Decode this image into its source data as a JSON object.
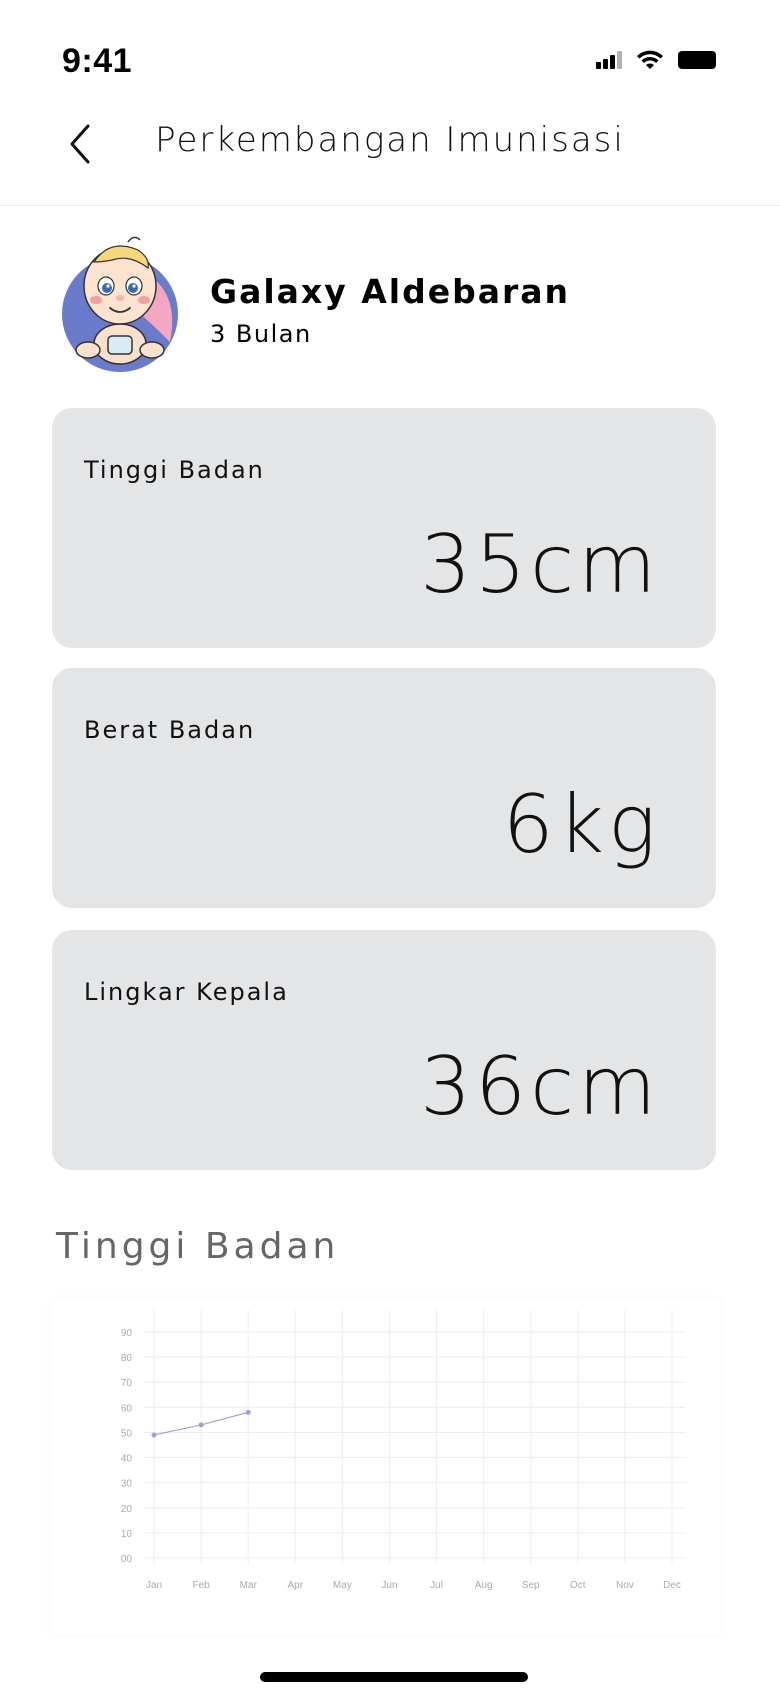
{
  "status": {
    "time": "9:41"
  },
  "nav": {
    "title": "Perkembangan Imunisasi"
  },
  "profile": {
    "name": "Galaxy Aldebaran",
    "age": "3 Bulan"
  },
  "metrics": [
    {
      "label": "Tinggi Badan",
      "value": "35cm"
    },
    {
      "label": "Berat Badan",
      "value": "6kg"
    },
    {
      "label": "Lingkar Kepala",
      "value": "36cm"
    }
  ],
  "chart_section": {
    "title": "Tinggi Badan"
  },
  "chart_data": {
    "type": "line",
    "title": "",
    "xlabel": "",
    "ylabel": "",
    "categories": [
      "Jan",
      "Feb",
      "Mar",
      "Apr",
      "May",
      "Jun",
      "Jul",
      "Aug",
      "Sep",
      "Oct",
      "Nov",
      "Dec"
    ],
    "y_ticks": [
      "00",
      "10",
      "20",
      "30",
      "40",
      "50",
      "60",
      "70",
      "80",
      "90"
    ],
    "ylim": [
      0,
      90
    ],
    "grid": true,
    "series": [
      {
        "values": [
          49,
          53,
          58
        ],
        "color": "#9ea0e0"
      }
    ]
  }
}
